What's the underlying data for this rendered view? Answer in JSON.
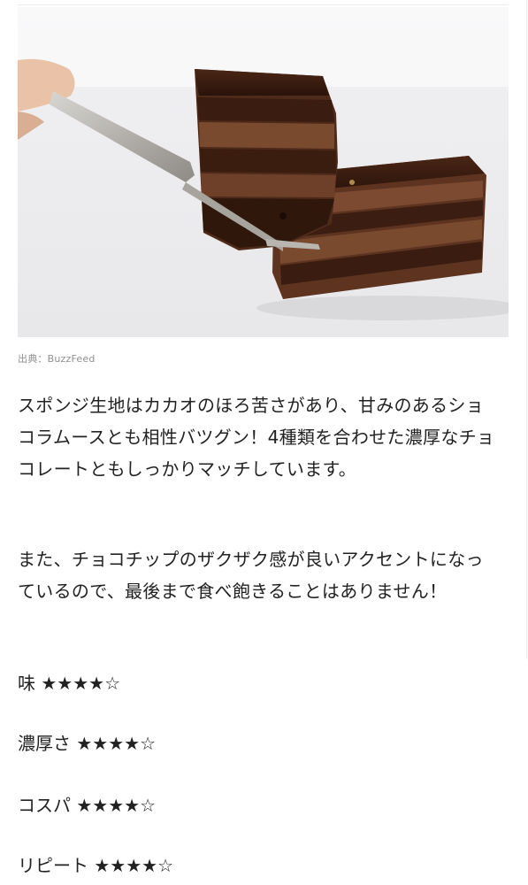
{
  "image": {
    "credit": "出典：BuzzFeed"
  },
  "article": {
    "paragraphs": [
      "スポンジ生地はカカオのほろ苦さがあり、甘みのあるショコラムースとも相性バツグン！4種類を合わせた濃厚なチョコレートともしっかりマッチしています。",
      "また、チョコチップのザクザク感が良いアクセントになっているので、最後まで食べ飽きることはありません！"
    ]
  },
  "ratings": [
    {
      "label": "味",
      "stars": "★★★★☆",
      "value": 4,
      "max": 5
    },
    {
      "label": "濃厚さ",
      "stars": "★★★★☆",
      "value": 4,
      "max": 5
    },
    {
      "label": "コスパ",
      "stars": "★★★★☆",
      "value": 4,
      "max": 5
    },
    {
      "label": "リピート",
      "stars": "★★★★☆",
      "value": 4,
      "max": 5
    }
  ]
}
